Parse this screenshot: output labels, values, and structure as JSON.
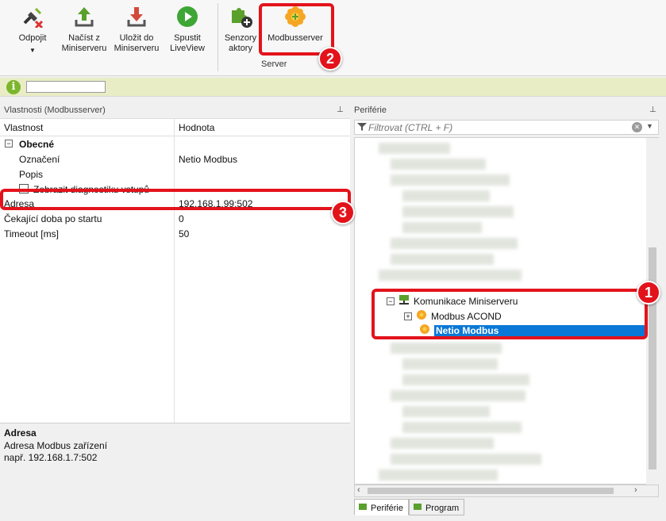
{
  "ribbon": {
    "buttons": [
      {
        "label": "Odpojit",
        "icon": "disconnect-icon"
      },
      {
        "label": "Načíst z\nMiniserveru",
        "icon": "upload-icon"
      },
      {
        "label": "Uložit do\nMiniserveru",
        "icon": "download-icon"
      },
      {
        "label": "Spustit\nLiveView",
        "icon": "play-icon"
      },
      {
        "label": "Senzory\naktory",
        "icon": "puzzle-add-icon"
      },
      {
        "label": "Modbusserver",
        "icon": "modbus-server-icon"
      }
    ],
    "group_label": "Server"
  },
  "left_pane": {
    "title": "Vlastnosti (Modbusserver)",
    "pin": "⊥",
    "columns": [
      "Vlastnost",
      "Hodnota"
    ],
    "group": "Obecné",
    "rows": [
      {
        "key": "Označení",
        "value": "Netio Modbus"
      },
      {
        "key": "Popis",
        "value": ""
      },
      {
        "key": "Zobrazit diagnostiku vstupů",
        "value": ""
      },
      {
        "key": "Adresa",
        "value": "192.168.1.99:502"
      },
      {
        "key": "Čekající doba po startu",
        "value": "0"
      },
      {
        "key": "Timeout [ms]",
        "value": "50"
      }
    ],
    "help": {
      "title": "Adresa",
      "line1": "Adresa Modbus zařízení",
      "line2": "např. 192.168.1.7:502"
    }
  },
  "right_pane": {
    "title": "Periférie",
    "pin": "⊥",
    "filter_placeholder": "Filtrovat (CTRL + F)",
    "tree": {
      "comm": "Komunikace Miniserveru",
      "item1": "Modbus ACOND",
      "item2": "Netio Modbus"
    },
    "tabs": [
      "Periférie",
      "Program"
    ]
  },
  "callouts": [
    "1",
    "2",
    "3"
  ],
  "colors": {
    "accent": "#e3131b",
    "selection": "#0a78d7",
    "infobar": "#e8edc6"
  }
}
